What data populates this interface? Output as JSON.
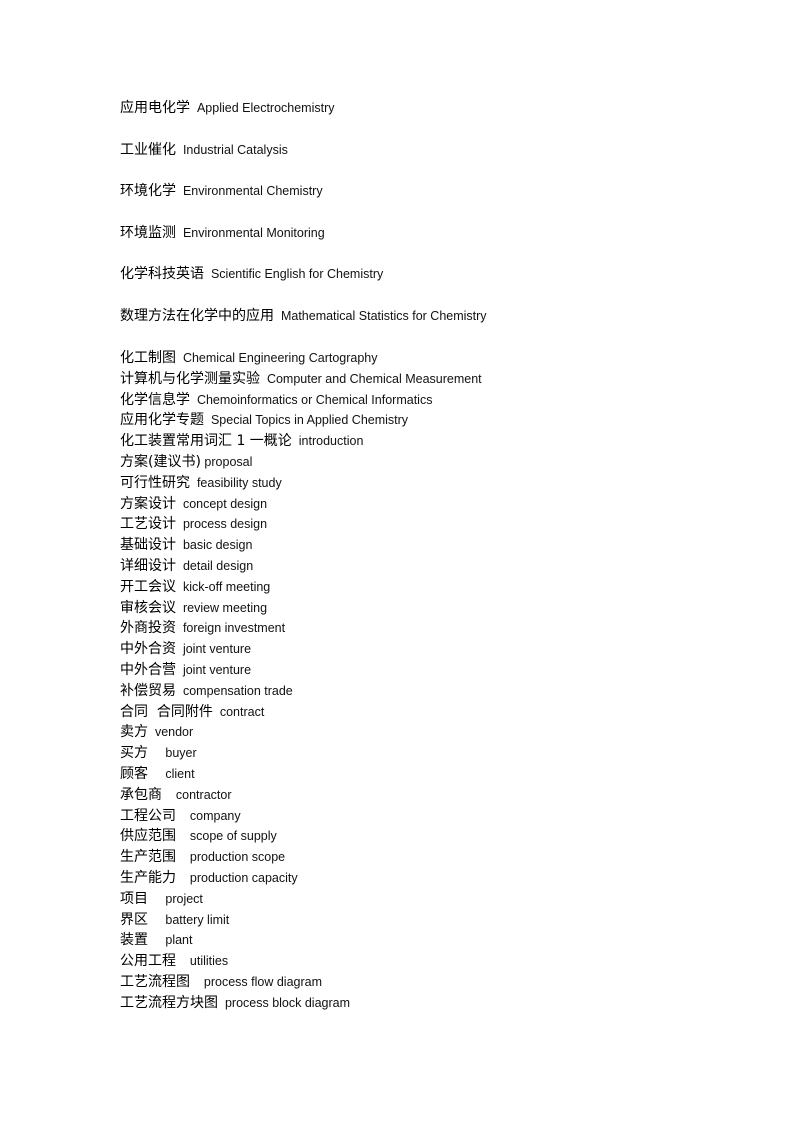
{
  "document": {
    "spaced_entries": [
      {
        "zh": "应用电化学",
        "sep": "  ",
        "en": "Applied Electrochemistry"
      },
      {
        "zh": "工业催化",
        "sep": "  ",
        "en": "Industrial Catalysis"
      },
      {
        "zh": "环境化学",
        "sep": "  ",
        "en": "Environmental Chemistry"
      },
      {
        "zh": "环境监测",
        "sep": "  ",
        "en": "Environmental Monitoring"
      },
      {
        "zh": "化学科技英语",
        "sep": "  ",
        "en": "Scientific English for Chemistry"
      },
      {
        "zh": "数理方法在化学中的应用",
        "sep": "  ",
        "en": "Mathematical Statistics for Chemistry"
      }
    ],
    "dense_entries": [
      {
        "zh": "化工制图",
        "sep": "  ",
        "en": "Chemical Engineering Cartography"
      },
      {
        "zh": "计算机与化学测量实验",
        "sep": "  ",
        "en": "Computer and Chemical Measurement"
      },
      {
        "zh": "化学信息学",
        "sep": "  ",
        "en": "Chemoinformatics or Chemical Informatics"
      },
      {
        "zh": "应用化学专题",
        "sep": "  ",
        "en": "Special Topics in Applied Chemistry"
      },
      {
        "zh": "化工装置常用词汇 1 一概论",
        "sep": "  ",
        "en": "introduction"
      },
      {
        "zh": "方案(建议书)",
        "sep": " ",
        "en": "proposal"
      },
      {
        "zh": "可行性研究",
        "sep": "  ",
        "en": "feasibility study"
      },
      {
        "zh": "方案设计",
        "sep": "  ",
        "en": "concept design"
      },
      {
        "zh": "工艺设计",
        "sep": "  ",
        "en": "process design"
      },
      {
        "zh": "基础设计",
        "sep": "  ",
        "en": "basic design"
      },
      {
        "zh": "详细设计",
        "sep": "  ",
        "en": "detail design"
      },
      {
        "zh": "开工会议",
        "sep": "  ",
        "en": "kick-off meeting"
      },
      {
        "zh": "审核会议",
        "sep": "  ",
        "en": "review meeting"
      },
      {
        "zh": "外商投资",
        "sep": "  ",
        "en": "foreign investment"
      },
      {
        "zh": "中外合资",
        "sep": "  ",
        "en": "joint venture"
      },
      {
        "zh": "中外合营",
        "sep": "  ",
        "en": "joint venture"
      },
      {
        "zh": "补偿贸易",
        "sep": "  ",
        "en": "compensation trade"
      },
      {
        "zh": "合同  合同附件",
        "sep": "  ",
        "en": "contract"
      },
      {
        "zh": "卖方",
        "sep": "  ",
        "en": "vendor"
      },
      {
        "zh": "买方",
        "sep": "     ",
        "en": "buyer"
      },
      {
        "zh": "顾客",
        "sep": "     ",
        "en": "client"
      },
      {
        "zh": "承包商",
        "sep": "    ",
        "en": "contractor"
      },
      {
        "zh": "工程公司",
        "sep": "    ",
        "en": "company"
      },
      {
        "zh": "供应范围",
        "sep": "    ",
        "en": "scope of supply"
      },
      {
        "zh": "生产范围",
        "sep": "    ",
        "en": "production scope"
      },
      {
        "zh": "生产能力",
        "sep": "    ",
        "en": "production capacity"
      },
      {
        "zh": "项目",
        "sep": "     ",
        "en": "project"
      },
      {
        "zh": "界区",
        "sep": "     ",
        "en": "battery limit"
      },
      {
        "zh": "装置",
        "sep": "     ",
        "en": "plant"
      },
      {
        "zh": "公用工程",
        "sep": "    ",
        "en": "utilities"
      },
      {
        "zh": "工艺流程图",
        "sep": "    ",
        "en": "process flow diagram"
      },
      {
        "zh": "工艺流程方块图",
        "sep": "  ",
        "en": "process block diagram"
      }
    ]
  }
}
